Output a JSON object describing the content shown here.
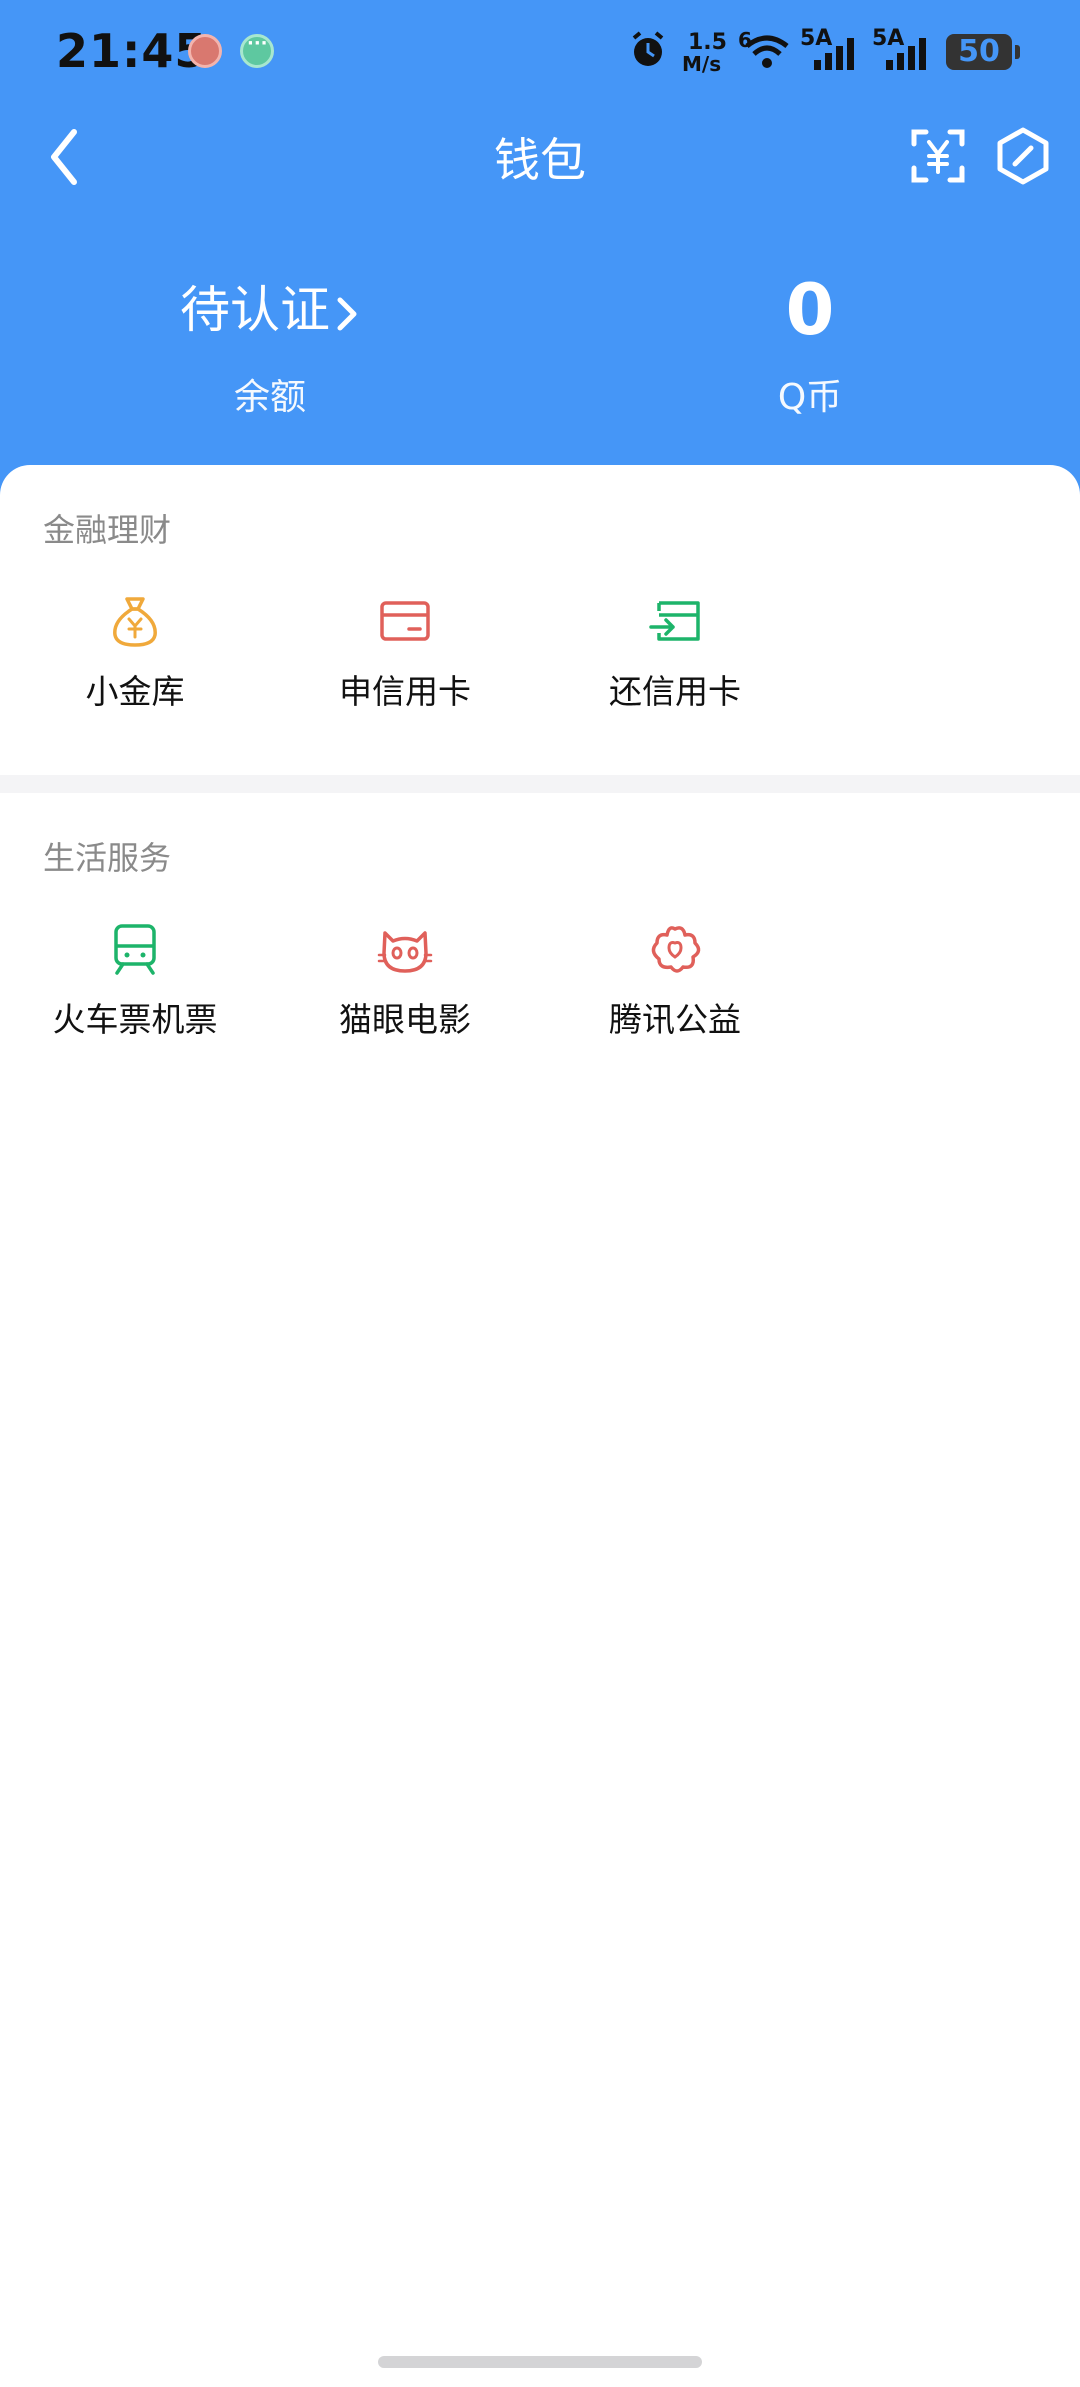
{
  "status_bar": {
    "time": "21:45",
    "speed_top": "1.5",
    "speed_bottom": "M/s",
    "wifi_label": "6",
    "signal1_label": "5A",
    "signal2_label": "5A",
    "battery": "50"
  },
  "nav": {
    "title": "钱包"
  },
  "balance": {
    "left_value": "待认证",
    "left_label": "余额",
    "right_value": "0",
    "right_label": "Q币"
  },
  "finance": {
    "title": "金融理财",
    "items": [
      {
        "label": "小金库",
        "icon": "money-bag-icon",
        "color": "#F0A93B"
      },
      {
        "label": "申信用卡",
        "icon": "credit-card-icon",
        "color": "#E0605A"
      },
      {
        "label": "还信用卡",
        "icon": "card-repay-icon",
        "color": "#1DB46A"
      }
    ]
  },
  "life": {
    "title": "生活服务",
    "items": [
      {
        "label": "火车票机票",
        "icon": "train-icon",
        "color": "#1DB46A"
      },
      {
        "label": "猫眼电影",
        "icon": "cat-icon",
        "color": "#E0605A"
      },
      {
        "label": "腾讯公益",
        "icon": "flower-icon",
        "color": "#E0605A"
      }
    ]
  },
  "colors": {
    "header_blue": "#4596F7",
    "section_title": "#8a8a8a"
  }
}
